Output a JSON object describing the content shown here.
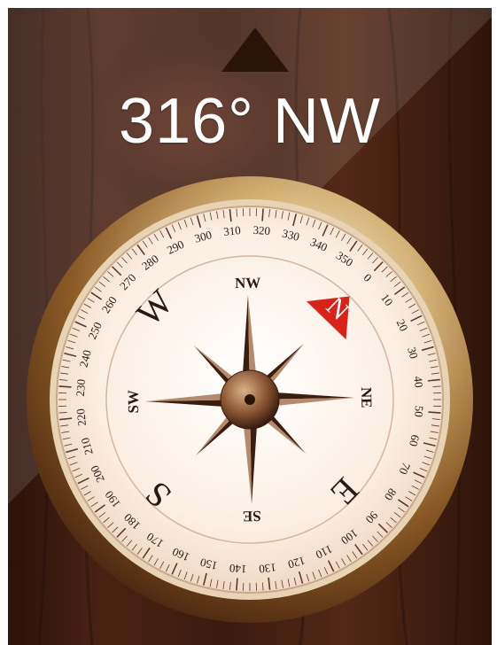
{
  "heading": {
    "degrees": 316,
    "direction": "NW",
    "text": "316° NW"
  },
  "compass": {
    "cardinals": [
      "N",
      "E",
      "S",
      "W"
    ],
    "intercardinals": [
      "NE",
      "SE",
      "SW",
      "NW"
    ],
    "degree_labels": [
      "0",
      "10",
      "20",
      "30",
      "40",
      "50",
      "60",
      "70",
      "80",
      "90",
      "100",
      "110",
      "120",
      "130",
      "140",
      "150",
      "160",
      "170",
      "180",
      "190",
      "200",
      "210",
      "220",
      "230",
      "240",
      "250",
      "260",
      "270",
      "280",
      "290",
      "300",
      "310",
      "320",
      "330",
      "340",
      "350"
    ],
    "rotation_deg": 316
  },
  "colors": {
    "needle_red": "#d8231b",
    "bezel_gold": "#b88a4a",
    "face": "#fbeee3",
    "wood": "#3a1a0f"
  }
}
